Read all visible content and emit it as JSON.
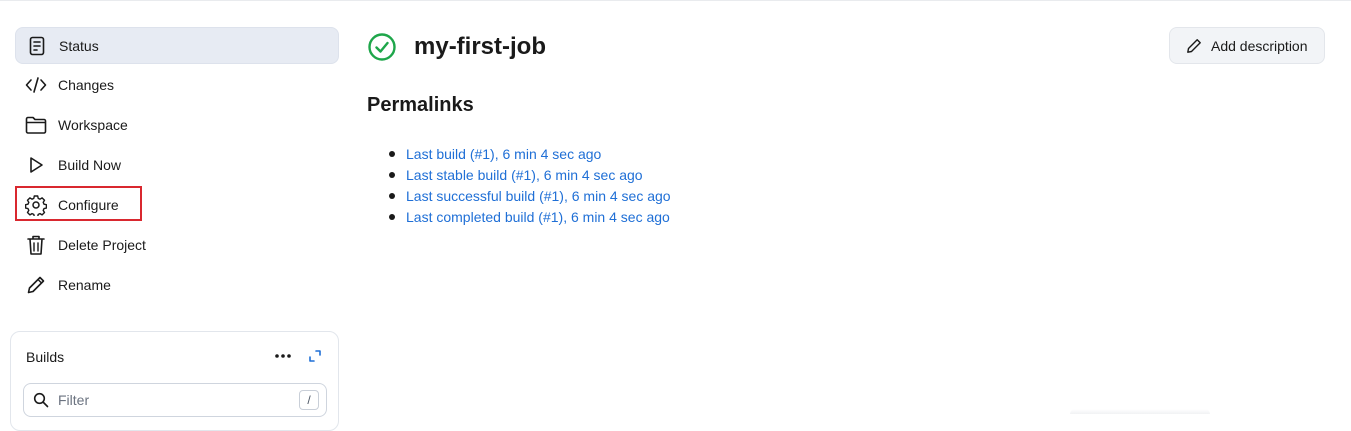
{
  "sidebar": {
    "items": [
      {
        "label": "Status",
        "icon": "document-icon",
        "active": true
      },
      {
        "label": "Changes",
        "icon": "code-icon"
      },
      {
        "label": "Workspace",
        "icon": "folder-icon"
      },
      {
        "label": "Build Now",
        "icon": "play-icon"
      },
      {
        "label": "Configure",
        "icon": "gear-icon",
        "highlighted": true
      },
      {
        "label": "Delete Project",
        "icon": "trash-icon"
      },
      {
        "label": "Rename",
        "icon": "pencil-icon"
      }
    ]
  },
  "builds": {
    "title": "Builds",
    "filter_placeholder": "Filter",
    "shortcut_key": "/"
  },
  "main": {
    "title": "my-first-job",
    "status_icon": "success-check-icon",
    "add_description_label": "Add description",
    "permalinks_heading": "Permalinks",
    "permalinks": [
      "Last build (#1), 6 min 4 sec ago",
      "Last stable build (#1), 6 min 4 sec ago",
      "Last successful build (#1), 6 min 4 sec ago",
      "Last completed build (#1), 6 min 4 sec ago"
    ]
  },
  "colors": {
    "link": "#1f6fd6",
    "success": "#1ea64a",
    "highlight": "#d9282f",
    "active_bg": "#e7ebf3"
  }
}
